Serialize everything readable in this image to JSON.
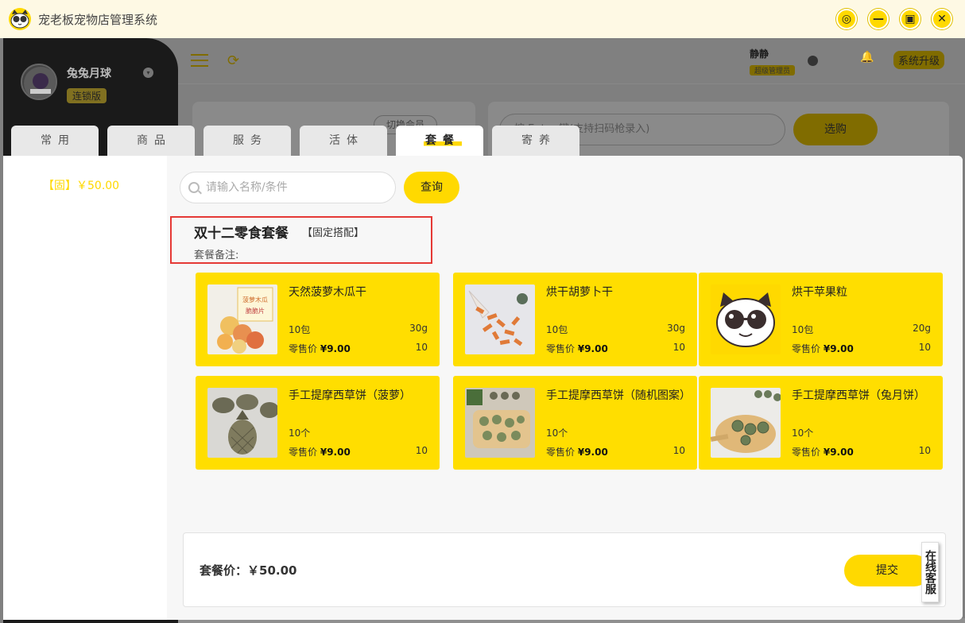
{
  "app": {
    "title": "宠老板宠物店管理系统"
  },
  "window_controls": [
    "settings-icon",
    "minimize-icon",
    "maximize-icon",
    "close-icon"
  ],
  "background_app": {
    "user": {
      "name": "兔兔月球",
      "edition": "连锁版"
    },
    "admin": {
      "name": "静静",
      "role": "超级管理员"
    },
    "upgrade_label": "系统升级",
    "switch_member_label": "切换会员",
    "scan_placeholder": "按 Enter 键(支持扫码枪录入)",
    "buy_label": "选购"
  },
  "tabs": [
    {
      "label": "常用",
      "active": false
    },
    {
      "label": "商品",
      "active": false
    },
    {
      "label": "服务",
      "active": false
    },
    {
      "label": "活体",
      "active": false
    },
    {
      "label": "套餐",
      "active": true
    },
    {
      "label": "寄养",
      "active": false
    }
  ],
  "package_list": [
    {
      "label": "【固】￥50.00"
    }
  ],
  "search": {
    "placeholder": "请输入名称/条件",
    "button_label": "查询"
  },
  "package": {
    "name": "双十二零食套餐",
    "type": "【固定搭配】",
    "note_label": "套餐备注:"
  },
  "items": [
    {
      "name": "天然菠萝木瓜干",
      "qty": "10包",
      "weight": "30g",
      "price_label": "零售价",
      "price": "¥9.00",
      "stock": "10",
      "thumb": "dried-fruit-bag"
    },
    {
      "name": "烘干胡萝卜干",
      "qty": "10包",
      "weight": "30g",
      "price_label": "零售价",
      "price": "¥9.00",
      "stock": "10",
      "thumb": "dried-carrot"
    },
    {
      "name": "烘干苹果粒",
      "qty": "10包",
      "weight": "20g",
      "price_label": "零售价",
      "price": "¥9.00",
      "stock": "10",
      "thumb": "cat-logo"
    },
    {
      "name": "手工提摩西草饼（菠萝）",
      "qty": "10个",
      "weight": "",
      "price_label": "零售价",
      "price": "¥9.00",
      "stock": "10",
      "thumb": "pineapple-cookie"
    },
    {
      "name": "手工提摩西草饼（随机图案）",
      "qty": "10个",
      "weight": "",
      "price_label": "零售价",
      "price": "¥9.00",
      "stock": "10",
      "thumb": "cookie-board"
    },
    {
      "name": "手工提摩西草饼（兔月饼）",
      "qty": "10个",
      "weight": "",
      "price_label": "零售价",
      "price": "¥9.00",
      "stock": "10",
      "thumb": "mooncake-board"
    }
  ],
  "footer": {
    "price_label": "套餐价：￥50.00",
    "submit_label": "提交",
    "customer_service_label": "在线客服"
  },
  "colors": {
    "accent": "#ffd900",
    "card": "#ffde00",
    "highlight_box": "#e53935"
  }
}
